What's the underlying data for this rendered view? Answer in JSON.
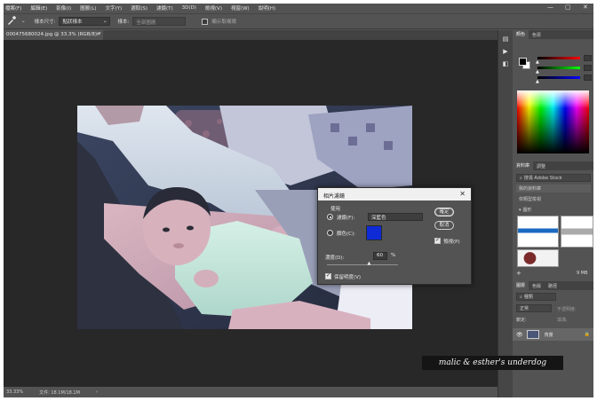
{
  "menu": [
    "檔案(F)",
    "編輯(E)",
    "影像(I)",
    "圖層(L)",
    "文字(Y)",
    "選取(S)",
    "濾鏡(T)",
    "3D(D)",
    "檢視(V)",
    "視窗(W)",
    "說明(H)"
  ],
  "window_controls": {
    "minimize": "—",
    "maximize": "▢",
    "close": "✕"
  },
  "options": {
    "sample_size_label": "樣本尺寸:",
    "sample_size_value": "點狀樣本",
    "sample_label": "樣本:",
    "sample_value": "全部圖層",
    "show_ring_label": "顯示取樣環"
  },
  "document_tab": {
    "title": "000475680024.jpg @ 33.3% (RGB/8) *",
    "close": "×"
  },
  "status": {
    "zoom": "33.33%",
    "doc_info": "文件: 18.1M/18.1M",
    "arrow": "›"
  },
  "watermark": "malic & esther's underdog",
  "panel": {
    "color_tabs": [
      "顏色",
      "色票"
    ],
    "library_tabs": [
      "資料庫",
      "調整"
    ],
    "library_search": "搜尋 Adobe Stock",
    "library_name": "我的資料庫",
    "library_group": "依類型檢視",
    "library_section": "圖形",
    "library_size": "9 MB",
    "layers_tabs": [
      "圖層",
      "色版",
      "路徑"
    ],
    "layers_kind": "種類",
    "layers_mode": "正常",
    "layers_opacity": "不透明度:",
    "layers_lock": "鎖定:",
    "layers_fill": "填滿:",
    "layer_name": "背景"
  },
  "dialog": {
    "title": "相片濾鏡",
    "close": "✕",
    "use_label": "使用",
    "filter_label": "濾鏡(F):",
    "filter_value": "深藍色",
    "color_label": "顏色(C):",
    "color_swatch": "#0f2bd6",
    "density_label": "濃度(D):",
    "density_value": "60",
    "density_unit": "%",
    "density_percent": 60,
    "preserve_label": "保留明度(V)",
    "ok_label": "確定",
    "cancel_label": "取消",
    "preview_label": "預視(P)"
  }
}
